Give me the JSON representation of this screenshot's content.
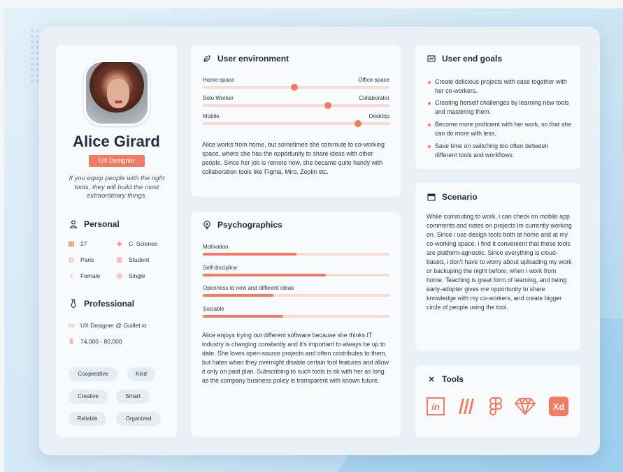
{
  "persona": {
    "name": "Alice Girard",
    "role": "UX Designer",
    "quote": "If you equip people with the right tools, they will build the most extraordinary things.",
    "personal_title": "Personal",
    "personal": {
      "age": "27",
      "education": "C. Science",
      "city": "Paris",
      "status": "Student",
      "gender": "Female",
      "relationship": "Single"
    },
    "professional_title": "Professional",
    "job": "UX Designer @ Guillet.io",
    "salary": "74,000 - 80,000",
    "traits": [
      "Cooperative",
      "Kind",
      "Creative",
      "Smart",
      "Reliable",
      "Organized"
    ]
  },
  "environment": {
    "title": "User environment",
    "sliders": [
      {
        "left": "Home-space",
        "right": "Office-space",
        "value": 0.49
      },
      {
        "left": "Solo Worker",
        "right": "Collaborator",
        "value": 0.67
      },
      {
        "left": "Mobile",
        "right": "Desktop",
        "value": 0.83
      }
    ],
    "text": "Alice works from home, but sometimes she commute to co-working space, where she has the opportunity to share ideas with other people. Since her job is remote now, she became quite handy with collaboration tools like Figma, Miro, Zeplin etc."
  },
  "psychographics": {
    "title": "Psychographics",
    "bars": [
      {
        "label": "Motivation",
        "value": 0.5
      },
      {
        "label": "Self-discipline",
        "value": 0.66
      },
      {
        "label": "Openness to new and different ideas",
        "value": 0.38
      },
      {
        "label": "Sociable",
        "value": 0.43
      }
    ],
    "text": "Alice enjoys trying out different software because she thinks IT industry is changing constantly and it's important to always be up to date. She loves open-source projects and often contributes to them, but hates when they overnight disable certain tool features and allow it only on paid plan. Subscribing to such tools is ok with her as long as the company business policy is transparent with known future."
  },
  "goals": {
    "title": "User end goals",
    "items": [
      "Create delicious projects with ease together with her co-workers.",
      "Creating herself challenges by learning new tools and mastering them.",
      "Become more proficient with her work, so that she can do more with less.",
      "Save time on switching too often between different tools and workflows."
    ]
  },
  "scenario": {
    "title": "Scenario",
    "text": "While commuting to work, i can check on mobile app comments and notes on projects im currently working on. Since i use design tools both at home and at my co-working space, i find it convenient that these tools are platform-agnostic. Since everything is cloud-based, i don't have to worry about uploading my work or backuping the night before, when i work from home. Teaching is great form of learning, and being early-adopter gives me opportunity to share knowledge with my co-workers, and create bigger circle of people using the tool."
  },
  "tools": {
    "title": "Tools",
    "items": [
      {
        "icon": "invision-icon",
        "text": "in"
      },
      {
        "icon": "miro-icon",
        "text": ""
      },
      {
        "icon": "figma-icon",
        "text": ""
      },
      {
        "icon": "sketch-icon",
        "text": ""
      },
      {
        "icon": "adobe-xd-icon",
        "text": "Xd"
      }
    ]
  },
  "colors": {
    "accent": "#f07c63",
    "ink": "#1e2f44",
    "track": "#f6dbd5"
  }
}
